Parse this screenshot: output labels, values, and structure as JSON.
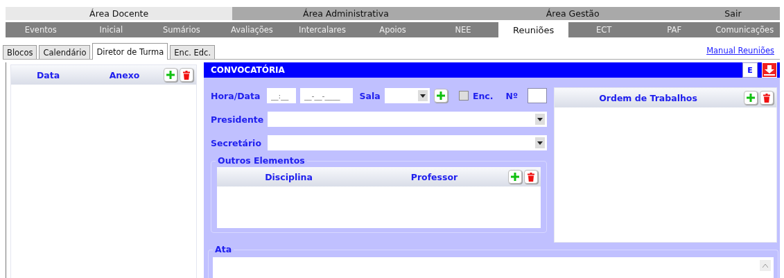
{
  "areas": [
    {
      "label": "Área Docente",
      "selected": true
    },
    {
      "label": "Área Administrativa",
      "selected": false
    },
    {
      "label": "Área Gestão",
      "selected": false
    },
    {
      "label": "Sair",
      "selected": false
    }
  ],
  "nav": [
    {
      "label": "Eventos",
      "selected": false
    },
    {
      "label": "Inicial",
      "selected": false
    },
    {
      "label": "Sumários",
      "selected": false
    },
    {
      "label": "Avaliações",
      "selected": false
    },
    {
      "label": "Intercalares",
      "selected": false
    },
    {
      "label": "Apoios",
      "selected": false
    },
    {
      "label": "NEE",
      "selected": false
    },
    {
      "label": "Reuniões",
      "selected": true
    },
    {
      "label": "ECT",
      "selected": false
    },
    {
      "label": "PAF",
      "selected": false
    },
    {
      "label": "Comunicações",
      "selected": false
    }
  ],
  "tabs": [
    {
      "label": "Blocos",
      "selected": false
    },
    {
      "label": "Calendário",
      "selected": false
    },
    {
      "label": "Diretor de Turma",
      "selected": true
    },
    {
      "label": "Enc. Edc.",
      "selected": false
    }
  ],
  "manual_link": "Manual Reuniões",
  "left_table": {
    "columns": [
      "Data",
      "Anexo"
    ]
  },
  "convocatoria": {
    "title": "CONVOCATÓRIA",
    "e_button": "E",
    "hora_label": "Hora/Data",
    "hora": {
      "placeholder": "__:__"
    },
    "data": {
      "placeholder": "__-__-____"
    },
    "sala_label": "Sala",
    "enc": {
      "label": "Enc.",
      "checked": false
    },
    "numero_label": "Nº",
    "presidente_label": "Presidente",
    "secretario_label": "Secretário",
    "outros": {
      "title": "Outros Elementos",
      "columns": [
        "Disciplina",
        "Professor"
      ]
    },
    "ordem": {
      "columns": [
        "Ordem de Trabalhos"
      ]
    },
    "ata": {
      "title": "Ata"
    }
  }
}
